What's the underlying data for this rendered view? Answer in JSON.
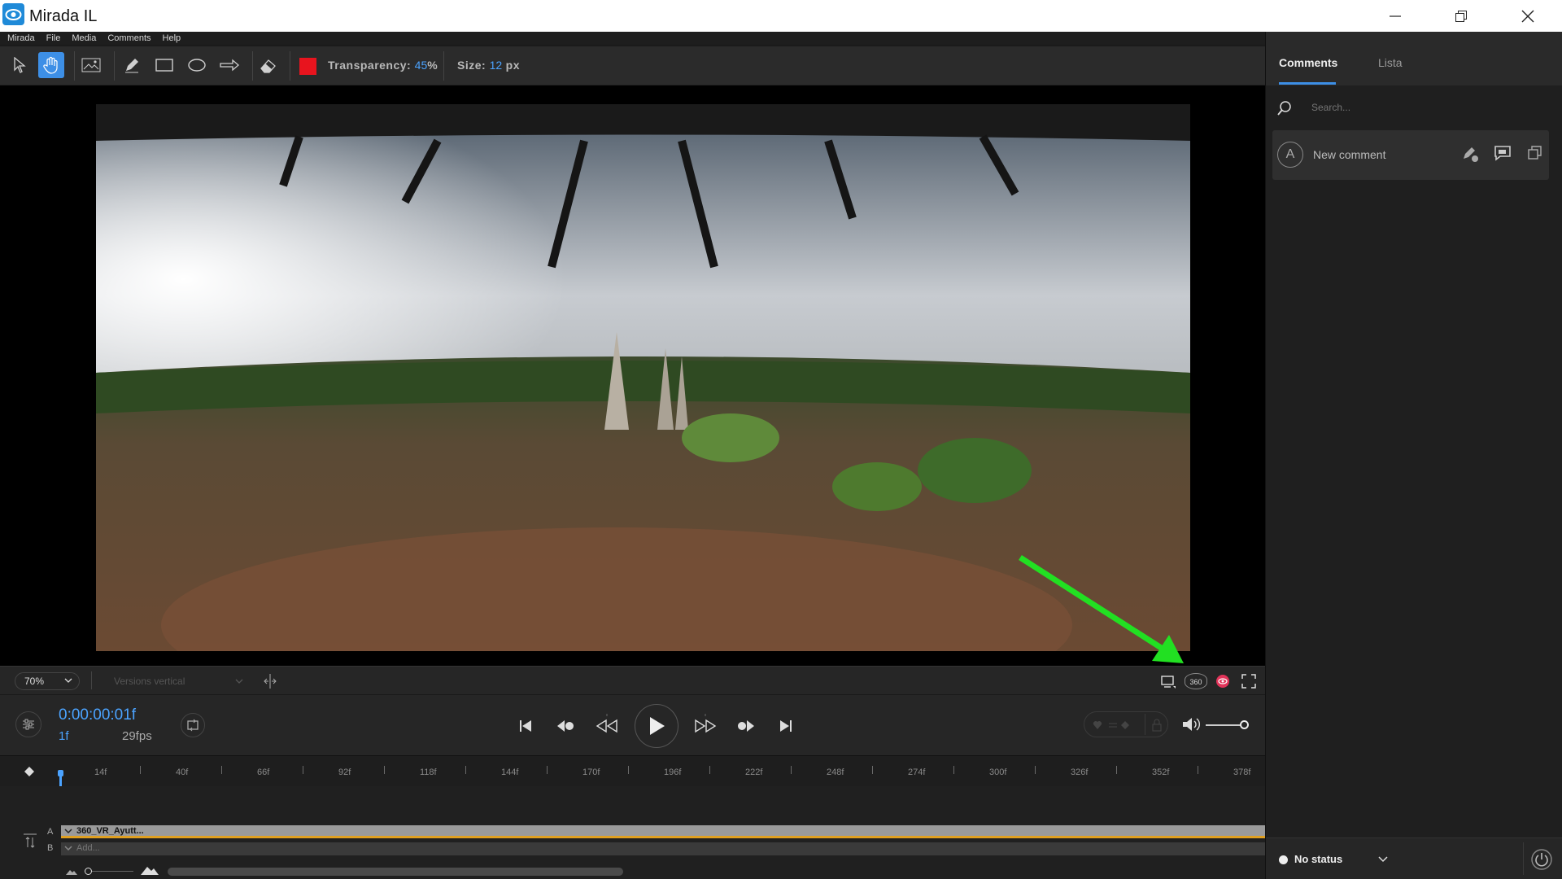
{
  "window": {
    "title": "Mirada IL"
  },
  "menu": {
    "items": [
      "Mirada",
      "File",
      "Media",
      "Comments",
      "Help"
    ]
  },
  "toolbar": {
    "transparency_label": "Transparency:",
    "transparency_value": "45",
    "transparency_unit": "%",
    "size_label": "Size:",
    "size_value": "12",
    "size_unit": "px",
    "color": "#e8141e",
    "accent": "#3d8fe6"
  },
  "viewbar": {
    "zoom": "70%",
    "versions": "Versions vertical"
  },
  "transport": {
    "timecode": "0:00:00:01f",
    "frame": "1f",
    "fps": "29fps"
  },
  "timeline": {
    "ticks": [
      "14f",
      "40f",
      "66f",
      "92f",
      "118f",
      "144f",
      "170f",
      "196f",
      "222f",
      "248f",
      "274f",
      "300f",
      "326f",
      "352f",
      "378f"
    ],
    "track_a_letter": "A",
    "track_b_letter": "B",
    "track_a_name": "360_VR_Ayutt...",
    "track_b_name": "Add..."
  },
  "panel": {
    "tab_comments": "Comments",
    "tab_list": "Lista",
    "search_placeholder": "Search...",
    "avatar_letter": "A",
    "new_comment": "New comment",
    "status": "No status"
  },
  "icons": {
    "view360": "360"
  }
}
